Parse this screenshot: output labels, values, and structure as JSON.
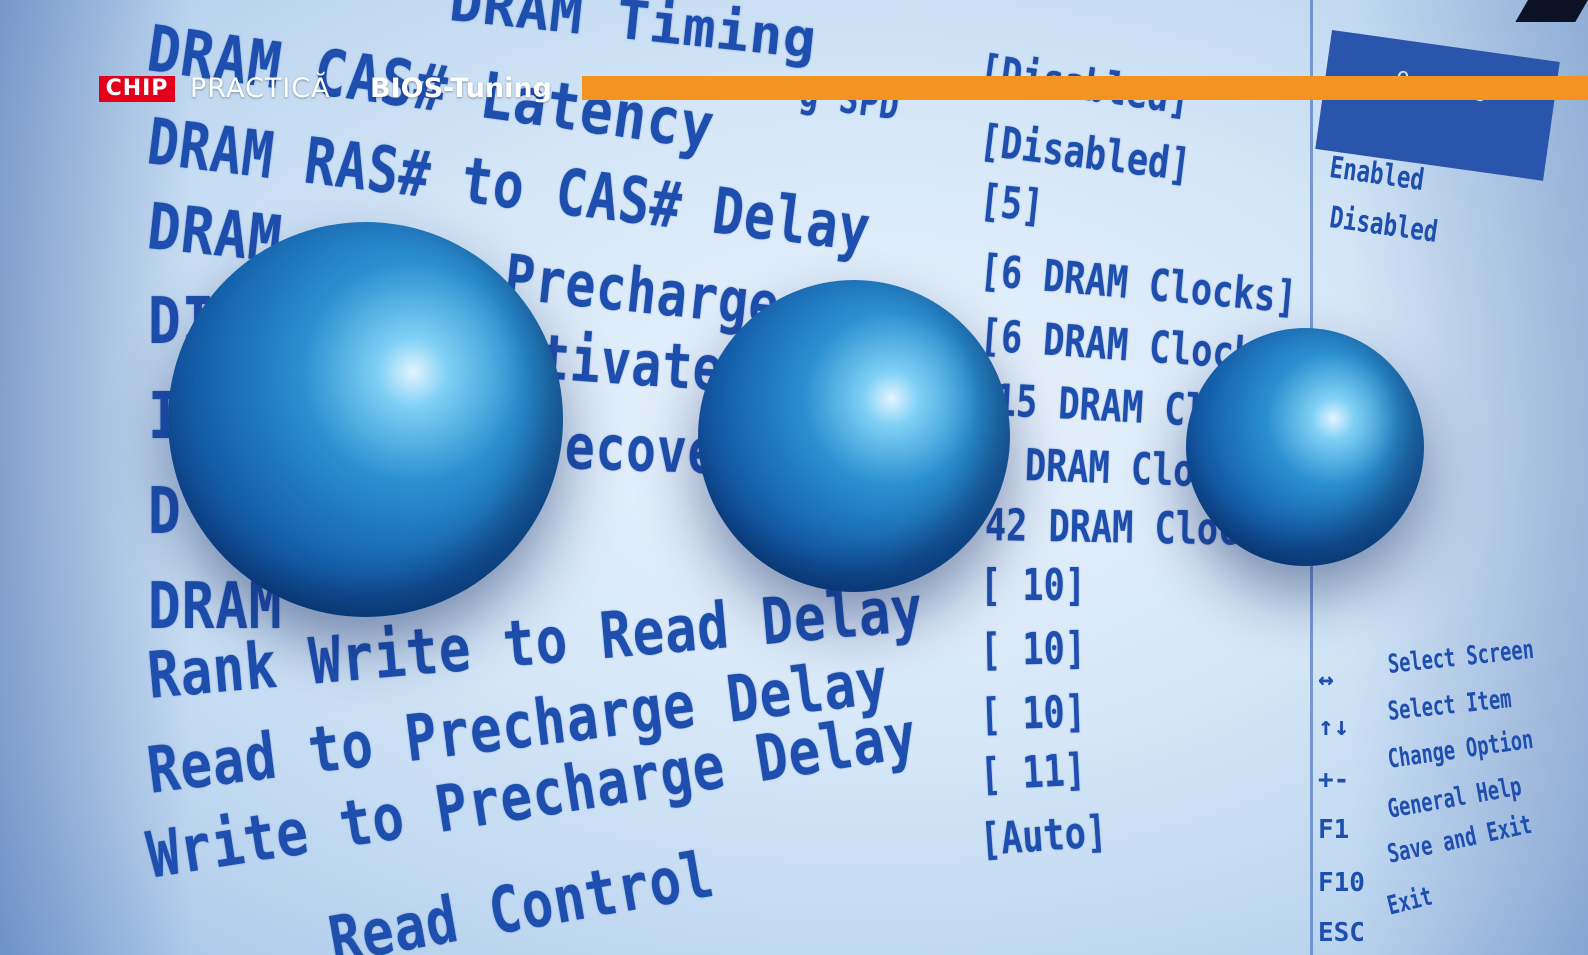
{
  "header": {
    "logo": "CHIP",
    "section": "PRACTICĂ",
    "topic": "BIOS-Tuning",
    "accent_color": "#f39321",
    "logo_color": "#e2001a"
  },
  "bios": {
    "rows": [
      {
        "label": "DRAM Timing",
        "value": ""
      },
      {
        "label": "DRAM CAS# Latency",
        "value": "[Disabled]"
      },
      {
        "label": "DRAM RAS# to CAS# Delay",
        "value": "[Disabled]"
      },
      {
        "label": "DRAM",
        "value": "[5]"
      },
      {
        "label": "DRAM",
        "value": "[6 DRAM Clocks]"
      },
      {
        "label": "DI",
        "value": "[6 DRAM Clocks]"
      },
      {
        "label": "I",
        "value": "15 DRAM Cloc"
      },
      {
        "label": "D",
        "value": "DRAM Clock"
      },
      {
        "label": "DRAM",
        "value": "42 DRAM Clock"
      },
      {
        "label": "",
        "value": "[ 10]"
      },
      {
        "label": "Rank Write to Read Delay",
        "value": "[ 10]"
      },
      {
        "label": "Read to Precharge Delay",
        "value": "[ 10]"
      },
      {
        "label": "Write to Precharge Delay",
        "value": "[ 11]"
      },
      {
        "label": "Read Control",
        "value": "[Auto]"
      }
    ],
    "fragments": {
      "precharge": "Precharge",
      "activate": "tivate",
      "recovery": "ecove",
      "spd": "g SPD"
    },
    "options": [
      "Enabled",
      "Disabled"
    ],
    "panel_title": "Options",
    "help": [
      {
        "key": "↔",
        "text": "Select Screen"
      },
      {
        "key": "↑↓",
        "text": "Select Item"
      },
      {
        "key": "+-",
        "text": "Change Option"
      },
      {
        "key": "F1",
        "text": "General Help"
      },
      {
        "key": "F10",
        "text": "Save and Exit"
      },
      {
        "key": "ESC",
        "text": "Exit"
      }
    ]
  }
}
